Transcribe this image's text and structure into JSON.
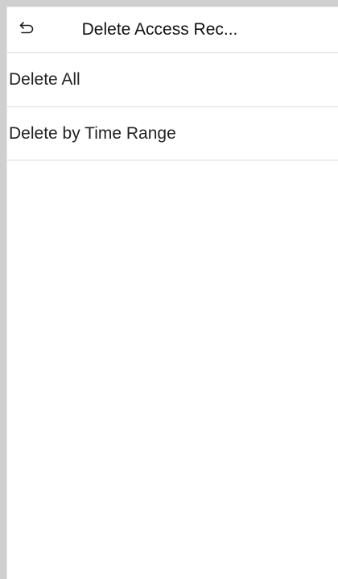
{
  "header": {
    "back_icon": "back-arrow-icon",
    "title": "Delete Access Rec..."
  },
  "menu": {
    "items": [
      {
        "label": "Delete All"
      },
      {
        "label": "Delete by Time Range"
      }
    ]
  }
}
